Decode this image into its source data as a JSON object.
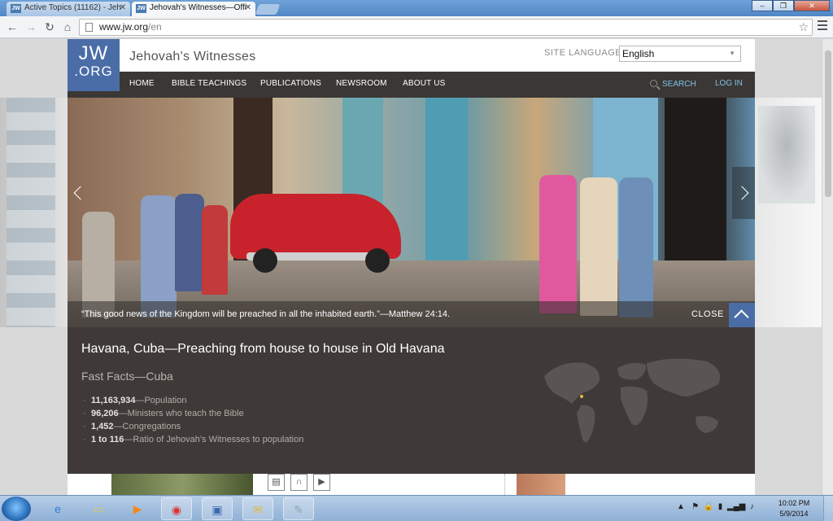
{
  "browser": {
    "tabs": [
      {
        "label": "Active Topics (11162) - Jeh",
        "favicon": "JW"
      },
      {
        "label": "Jehovah's Witnesses—Offi",
        "favicon": "JW"
      }
    ],
    "url_host": "www.jw.org",
    "url_path": "/en"
  },
  "site": {
    "logo_line1": "JW",
    "logo_line2": ".ORG",
    "title": "Jehovah's Witnesses",
    "language_label": "SITE LANGUAGE",
    "language_value": "English",
    "nav": [
      "HOME",
      "BIBLE TEACHINGS",
      "PUBLICATIONS",
      "NEWSROOM",
      "ABOUT US"
    ],
    "search_label": "SEARCH",
    "login_label": "LOG IN",
    "colors": {
      "brand_blue": "#4a6da7",
      "nav_bg": "#3b3735",
      "link_blue": "#7fc0e8",
      "panel_bg": "#3f3a38"
    }
  },
  "hero": {
    "caption": "“This good news of the Kingdom will be preached in all the inhabited earth.”—Matthew 24:14.",
    "close_label": "CLOSE"
  },
  "info": {
    "title": "Havana, Cuba—Preaching from house to house in Old Havana",
    "facts_title": "Fast Facts—Cuba",
    "facts": [
      {
        "value": "11,163,934",
        "label": "—Population"
      },
      {
        "value": "96,206",
        "label": "—Ministers who teach the Bible"
      },
      {
        "value": "1,452",
        "label": "—Congregations"
      },
      {
        "value": "1 to 116",
        "label": "—Ratio of Jehovah's Witnesses to population"
      }
    ]
  },
  "media_icons": [
    "document-icon",
    "headphones-icon",
    "play-icon"
  ],
  "taskbar": {
    "time": "10:02 PM",
    "date": "5/9/2014"
  }
}
